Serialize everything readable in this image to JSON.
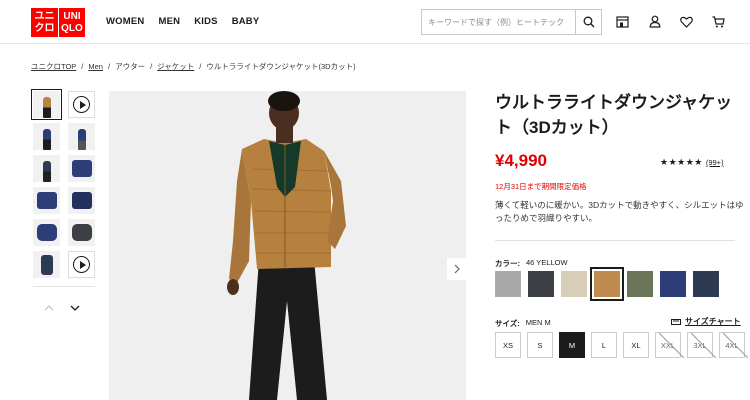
{
  "header": {
    "logo_top": "ユニ クロ",
    "logo_right": "UNI QLO",
    "logo_top_l1": "ユニ",
    "logo_top_l2": "クロ",
    "logo_right_l1": "UNI",
    "logo_right_l2": "QLO",
    "nav": [
      "WOMEN",
      "MEN",
      "KIDS",
      "BABY"
    ],
    "search_placeholder": "キーワードで探す（例）ヒートテック",
    "icons": [
      "search-icon",
      "store-icon",
      "account-icon",
      "wishlist-icon",
      "cart-icon"
    ]
  },
  "breadcrumb": {
    "items": [
      "ユニクロTOP",
      "Men",
      "アウター",
      "ジャケット",
      "ウルトラライトダウンジャケット(3Dカット)"
    ],
    "separator": "/"
  },
  "product": {
    "title": "ウルトラライトダウンジャケット（3Dカット）",
    "price": "¥4,990",
    "rating_stars": "★★★★★",
    "rating_count": "(99+)",
    "limited_notice": "12月31日まで期間限定価格",
    "description": "薄くて軽いのに暖かい。3Dカットで動きやすく、シルエットはゆったりめで羽織りやすい。"
  },
  "color": {
    "label": "カラー:",
    "selected": "46 YELLOW",
    "swatches": [
      {
        "name": "gray",
        "hex": "#a9a9a9"
      },
      {
        "name": "dark-gray",
        "hex": "#3c3f44"
      },
      {
        "name": "beige",
        "hex": "#d7cdb8"
      },
      {
        "name": "yellow",
        "hex": "#c08b4e",
        "selected": true
      },
      {
        "name": "olive",
        "hex": "#6b7659"
      },
      {
        "name": "blue",
        "hex": "#2c3d78"
      },
      {
        "name": "navy",
        "hex": "#2e3a52"
      }
    ]
  },
  "size": {
    "label": "サイズ:",
    "selected": "MEN M",
    "chart_link": "サイズチャート",
    "options": [
      {
        "label": "XS",
        "available": true
      },
      {
        "label": "S",
        "available": true
      },
      {
        "label": "M",
        "available": true,
        "selected": true
      },
      {
        "label": "L",
        "available": true
      },
      {
        "label": "XL",
        "available": true
      },
      {
        "label": "XXL",
        "available": false
      },
      {
        "label": "3XL",
        "available": false
      },
      {
        "label": "4XL",
        "available": false
      }
    ]
  },
  "colors": {
    "brand_red": "#ff0000",
    "price_red": "#e00000"
  }
}
